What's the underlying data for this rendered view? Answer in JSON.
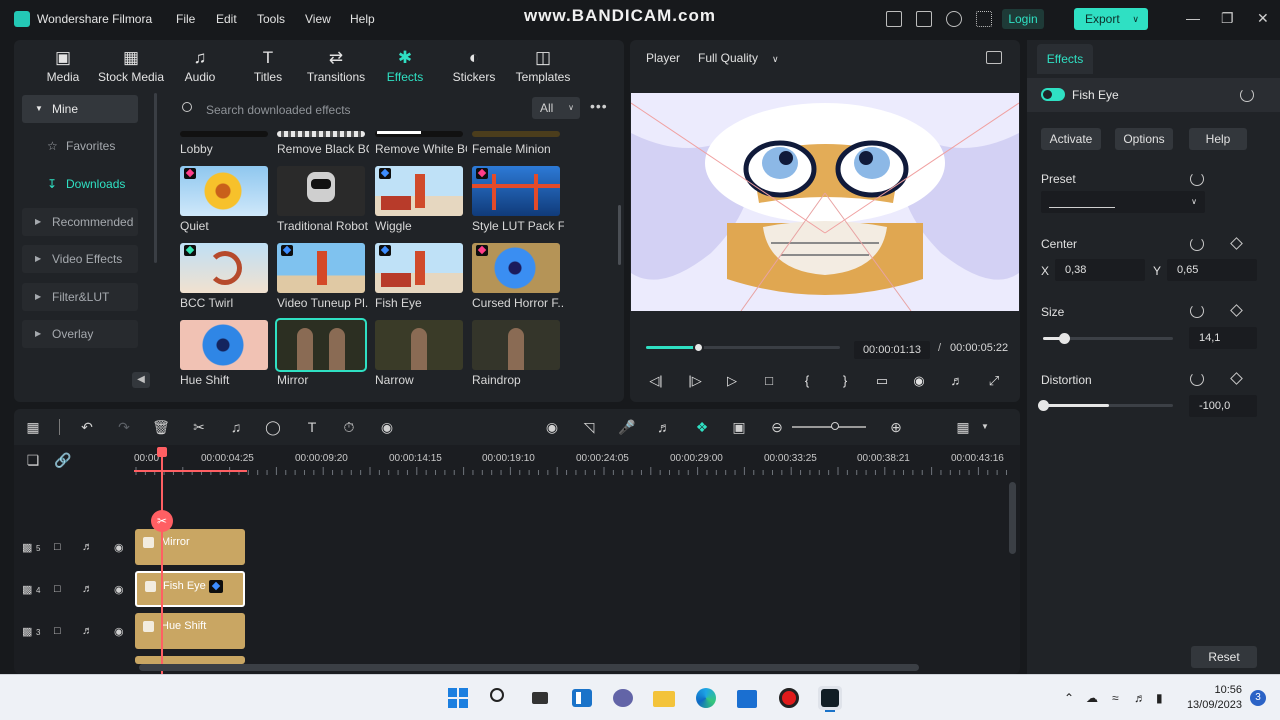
{
  "app": {
    "name": "Wondershare Filmora"
  },
  "menu": [
    "File",
    "Edit",
    "Tools",
    "View",
    "Help"
  ],
  "watermark": "www.BANDICAM.com",
  "header": {
    "login_label": "Login",
    "export_label": "Export"
  },
  "media_tabs": [
    {
      "label": "Media",
      "icon": "media-icon"
    },
    {
      "label": "Stock Media",
      "icon": "stock-media-icon"
    },
    {
      "label": "Audio",
      "icon": "music-note-icon"
    },
    {
      "label": "Titles",
      "icon": "titles-icon"
    },
    {
      "label": "Transitions",
      "icon": "transitions-icon"
    },
    {
      "label": "Effects",
      "icon": "effects-icon",
      "active": true
    },
    {
      "label": "Stickers",
      "icon": "stickers-icon"
    },
    {
      "label": "Templates",
      "icon": "templates-icon"
    }
  ],
  "sidebar": {
    "mine_label": "Mine",
    "favorites_label": "Favorites",
    "downloads_label": "Downloads",
    "items": [
      "Recommended",
      "Video Effects",
      "Filter&LUT",
      "Overlay"
    ]
  },
  "search": {
    "placeholder": "Search downloaded effects",
    "filter_value": "All"
  },
  "effects_rows": [
    [
      "Lobby",
      "Remove Black BG",
      "Remove White BG",
      "Female Minion"
    ],
    [
      "Quiet",
      "Traditional Robot",
      "Wiggle",
      "Style LUT Pack F..."
    ],
    [
      "BCC Twirl",
      "Video Tuneup Pl...",
      "Fish Eye",
      "Cursed Horror F..."
    ],
    [
      "Hue Shift",
      "Mirror",
      "Narrow",
      "Raindrop"
    ]
  ],
  "player": {
    "label": "Player",
    "quality": "Full Quality",
    "current_time": "00:00:01:13",
    "separator": "/",
    "total_time": "00:00:05:22",
    "progress": 0.27
  },
  "props": {
    "tab_label": "Effects",
    "effect_name": "Fish Eye",
    "buttons": [
      "Activate",
      "Options",
      "Help"
    ],
    "preset_label": "Preset",
    "center_label": "Center",
    "x_label": "X",
    "x_value": "0,38",
    "y_label": "Y",
    "y_value": "0,65",
    "size_label": "Size",
    "size_value": "14,1",
    "size_level": 0.16,
    "distortion_label": "Distortion",
    "distortion_value": "-100,0",
    "distortion_level": 0.0,
    "reset_label": "Reset"
  },
  "timeline": {
    "ruler": [
      "00:00",
      "00:00:04:25",
      "00:00:09:20",
      "00:00:14:15",
      "00:00:19:10",
      "00:00:24:05",
      "00:00:29:00",
      "00:00:33:25",
      "00:00:38:21",
      "00:00:43:16"
    ],
    "tracks": [
      {
        "num": "5",
        "clip": "Mirror"
      },
      {
        "num": "4",
        "clip": "Fish Eye",
        "selected": true
      },
      {
        "num": "3",
        "clip": "Hue Shift"
      }
    ]
  },
  "taskbar": {
    "time": "10:56",
    "date": "13/09/2023",
    "notifications": "3"
  },
  "colors": {
    "accent": "#2fe0c3",
    "clip": "#c9a663",
    "playhead": "#ff5f63"
  }
}
